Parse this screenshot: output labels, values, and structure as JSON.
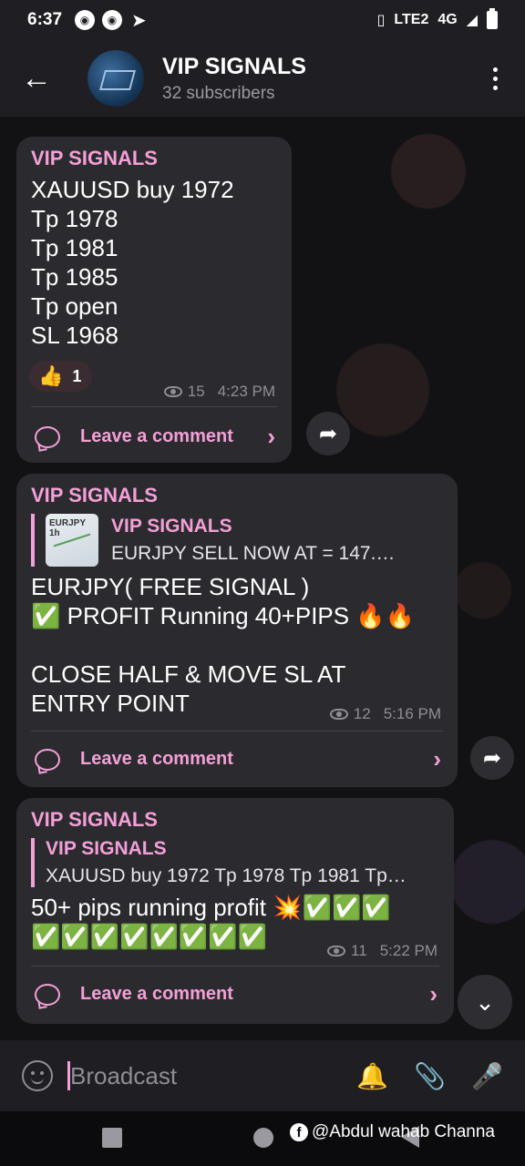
{
  "status_bar": {
    "time": "6:37",
    "network": "4G",
    "lte": "LTE2"
  },
  "header": {
    "title": "VIP SIGNALS",
    "subtitle": "32 subscribers"
  },
  "messages": [
    {
      "sender": "VIP SIGNALS",
      "text": "XAUUSD buy 1972\nTp 1978\nTp 1981\nTp 1985\nTp open\nSL 1968",
      "reaction": {
        "emoji": "👍",
        "count": "1"
      },
      "views": "15",
      "time": "4:23 PM",
      "comment_label": "Leave a comment"
    },
    {
      "sender": "VIP SIGNALS",
      "quote": {
        "title": "VIP SIGNALS",
        "text": "EURJPY  SELL  NOW  AT = 147.…",
        "thumb_label": "EURJPY 1h"
      },
      "text": "EURJPY( FREE SIGNAL )\n✅ PROFIT Running 40+PIPS 🔥🔥\n\nCLOSE HALF & MOVE SL AT\nENTRY POINT",
      "views": "12",
      "time": "5:16 PM",
      "comment_label": "Leave a comment"
    },
    {
      "sender": "VIP SIGNALS",
      "quote": {
        "title": "VIP SIGNALS",
        "text": "XAUUSD buy 1972 Tp 1978 Tp 1981 Tp…"
      },
      "text": "50+ pips running profit 💥✅✅✅\n✅✅✅✅✅✅✅✅",
      "views": "11",
      "time": "5:22 PM",
      "comment_label": "Leave a comment"
    }
  ],
  "input": {
    "placeholder": "Broadcast"
  },
  "watermark": "@Abdul wahab Channa",
  "colors": {
    "accent": "#f3a0d6",
    "bubble": "#2b2a2f",
    "header": "#1f1e22"
  }
}
